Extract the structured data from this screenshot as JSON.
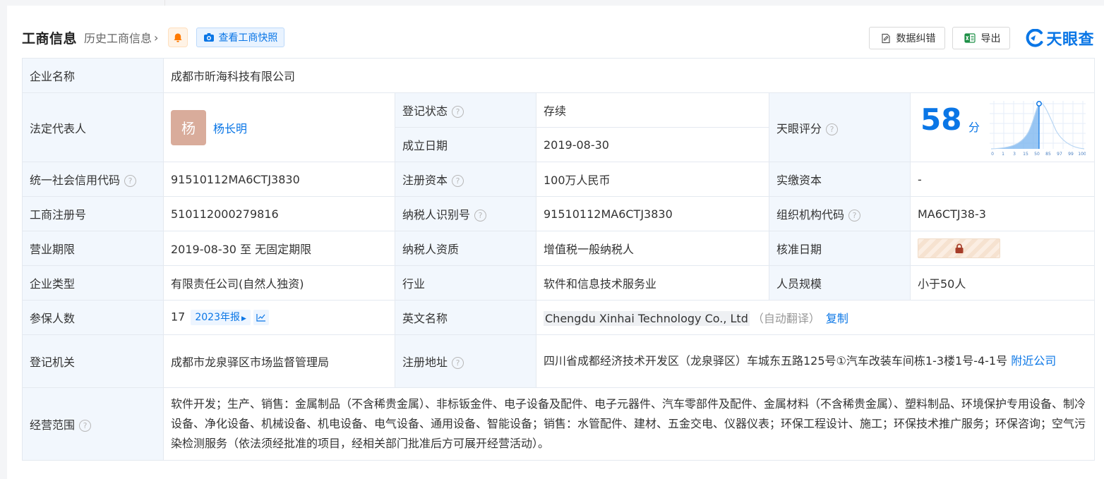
{
  "header": {
    "title": "工商信息",
    "history_link": "历史工商信息",
    "snapshot_button": "查看工商快照",
    "correction_button": "数据纠错",
    "export_button": "导出",
    "brand": "天眼查"
  },
  "company": {
    "name_label": "企业名称",
    "name": "成都市昕海科技有限公司",
    "legal_rep_label": "法定代表人",
    "legal_rep_avatar": "杨",
    "legal_rep": "杨长明",
    "reg_status_label": "登记状态",
    "reg_status": "存续",
    "found_date_label": "成立日期",
    "found_date": "2019-08-30",
    "tianyan_score_label": "天眼评分",
    "tianyan_score": "58",
    "score_unit": "分",
    "credit_code_label": "统一社会信用代码",
    "credit_code": "91510112MA6CTJ3830",
    "reg_capital_label": "注册资本",
    "reg_capital": "100万人民币",
    "paid_capital_label": "实缴资本",
    "paid_capital": "-",
    "reg_no_label": "工商注册号",
    "reg_no": "510112000279816",
    "taxpayer_id_label": "纳税人识别号",
    "taxpayer_id": "91510112MA6CTJ3830",
    "org_code_label": "组织机构代码",
    "org_code": "MA6CTJ38-3",
    "biz_term_label": "营业期限",
    "biz_term": "2019-08-30 至 无固定期限",
    "taxpayer_qual_label": "纳税人资质",
    "taxpayer_qual": "增值税一般纳税人",
    "approve_date_label": "核准日期",
    "company_type_label": "企业类型",
    "company_type": "有限责任公司(自然人独资)",
    "industry_label": "行业",
    "industry": "软件和信息技术服务业",
    "staff_size_label": "人员规模",
    "staff_size": "小于50人",
    "insured_label": "参保人数",
    "insured_count": "17",
    "annual_report_btn": "2023年报",
    "english_name_label": "英文名称",
    "english_name": "Chengdu Xinhai Technology Co., Ltd",
    "auto_translate": "（自动翻译）",
    "copy_link": "复制",
    "reg_authority_label": "登记机关",
    "reg_authority": "成都市龙泉驿区市场监督管理局",
    "reg_address_label": "注册地址",
    "reg_address": "四川省成都经济技术开发区（龙泉驿区）车城东五路125号①汽车改装车间栋1-3楼1号-4-1号 ",
    "nearby_link": "附近公司",
    "scope_label": "经营范围",
    "scope": "软件开发；生产、销售：金属制品（不含稀贵金属）、非标钣金件、电子设备及配件、电子元器件、汽车零部件及配件、金属材料（不含稀贵金属）、塑料制品、环境保护专用设备、制冷设备、净化设备、机械设备、机电设备、电气设备、通用设备、智能设备；销售：水管配件、建材、五金交电、仪器仪表；环保工程设计、施工；环保技术推广服务；环保咨询；空气污染检测服务（依法须经批准的项目，经相关部门批准后方可展开经营活动）。"
  },
  "score_chart": {
    "ticks": [
      "0",
      "1",
      "3",
      "15",
      "50",
      "85",
      "97",
      "99",
      "100"
    ]
  },
  "icons": {
    "question": "?",
    "chevron": "›",
    "bell": "bell-icon",
    "camera": "camera-icon",
    "lock": "lock-icon",
    "trend": "trend-chart-icon"
  },
  "colors": {
    "accent": "#0a76e6",
    "status_green": "#0d9a3c",
    "label_bg": "#f2f7fd",
    "border": "#e4e9f0",
    "avatar_bg": "#d9ac9b"
  }
}
